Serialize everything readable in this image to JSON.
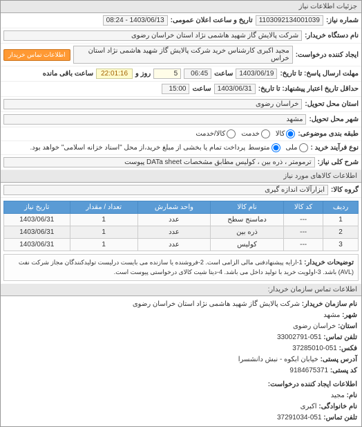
{
  "header": {
    "title": "جزئیات اطلاعات نیاز"
  },
  "fields": {
    "need_no_label": "شماره نیاز:",
    "need_no": "1103092134001039",
    "announce_label": "تاریخ و ساعت اعلان عمومی:",
    "announce": "1403/06/13 - 08:24",
    "buyer_name_label": "نام دستگاه خریدار:",
    "buyer_name": "شرکت پالایش گاز شهید هاشمی نژاد   استان خراسان رضوی",
    "creator_label": "ایجاد کننده درخواست:",
    "creator": "مجید اکبری کارشناس خرید شرکت پالایش گاز شهید هاشمی نژاد   استان خراس",
    "contact_btn": "اطلاعات تماس خریدار",
    "deadline_to_label": "مهلت ارسال پاسخ: تا تاریخ:",
    "deadline_date": "1403/06/19",
    "time_label": "ساعت",
    "deadline_time": "06:45",
    "days_label": "روز و",
    "days_value": "5",
    "timer": "22:01:16",
    "remain_label": "ساعت باقی مانده",
    "validity_to_label": "حداقل تاریخ اعتبار پیشنهاد: تا تاریخ:",
    "validity_date": "1403/06/31",
    "validity_time": "15:00",
    "province_label": "استان محل تحویل:",
    "province": "خراسان رضوی",
    "city_label": "شهر محل تحویل:",
    "city": "مشهد",
    "packing_label": "طبقه بندی موضوعی:",
    "packing_opts": {
      "kala": "کالا",
      "khadamat": "خدمت",
      "kala_khadamat": "کالا/خدمت"
    },
    "buy_type_label": "نوع فرآیند خرید :",
    "buy_opts": {
      "meli": "ملی",
      "avg": "متوسط"
    },
    "pay_note": "پرداخت تمام یا بخشی از مبلغ خرید،از محل \"اسناد خزانه اسلامی\" خواهد بود.",
    "desc_label": "شرح کلی نیاز:",
    "desc": "ترمومتر ، ذره بین ، کولیس مطابق مشخصات DATa sheet پیوست",
    "goods_header": "اطلاعات کالاهای مورد نیاز",
    "group_label": "گروه کالا:",
    "group": "ابزارآلات اندازه گیری"
  },
  "table": {
    "headers": [
      "ردیف",
      "کد کالا",
      "نام کالا",
      "واحد شمارش",
      "تعداد / مقدار",
      "تاریخ نیاز"
    ],
    "rows": [
      [
        "1",
        "---",
        "دماسنج سطح",
        "عدد",
        "1",
        "1403/06/31"
      ],
      [
        "2",
        "---",
        "ذره بین",
        "عدد",
        "1",
        "1403/06/31"
      ],
      [
        "3",
        "---",
        "کولیس",
        "عدد",
        "1",
        "1403/06/31"
      ]
    ]
  },
  "notes": {
    "label": "توضیحات خریدار:",
    "text": "1-ارایه پیشنهادفنی مالی الزامی است. 2-فروشنده یا سازنده می بایست درلیست تولیدکنندگان مجاز شرکت نفت (AVL) باشد. 3-اولویت خرید با تولید داخل می باشد. 4-دیتا شیت کالای درخواستی پیوست است."
  },
  "contact": {
    "header": "اطلاعات تماس سازمان خریدار:",
    "org_label": "نام سازمان خریدار:",
    "org": "شرکت پالایش گاز شهید هاشمی نژاد استان خراسان رضوی",
    "city_label": "شهر:",
    "city": "مشهد",
    "province_label": "استان:",
    "province": "خراسان رضوی",
    "phone_label": "تلفن تماس:",
    "phone": "051-33002791",
    "fax_label": "فکس:",
    "fax": "051-37285010",
    "addr_label": "آدرس پستی:",
    "addr": "خیابان ابکوه - نبش دانشسرا",
    "postal_label": "کد پستی:",
    "postal": "9184675371",
    "creator_header": "اطلاعات ایجاد کننده درخواست:",
    "name_label": "نام:",
    "name": "مجید",
    "family_label": "نام خانوادگی:",
    "family": "اکبری",
    "cphone_label": "تلفن تماس:",
    "cphone": "051-37291034"
  }
}
